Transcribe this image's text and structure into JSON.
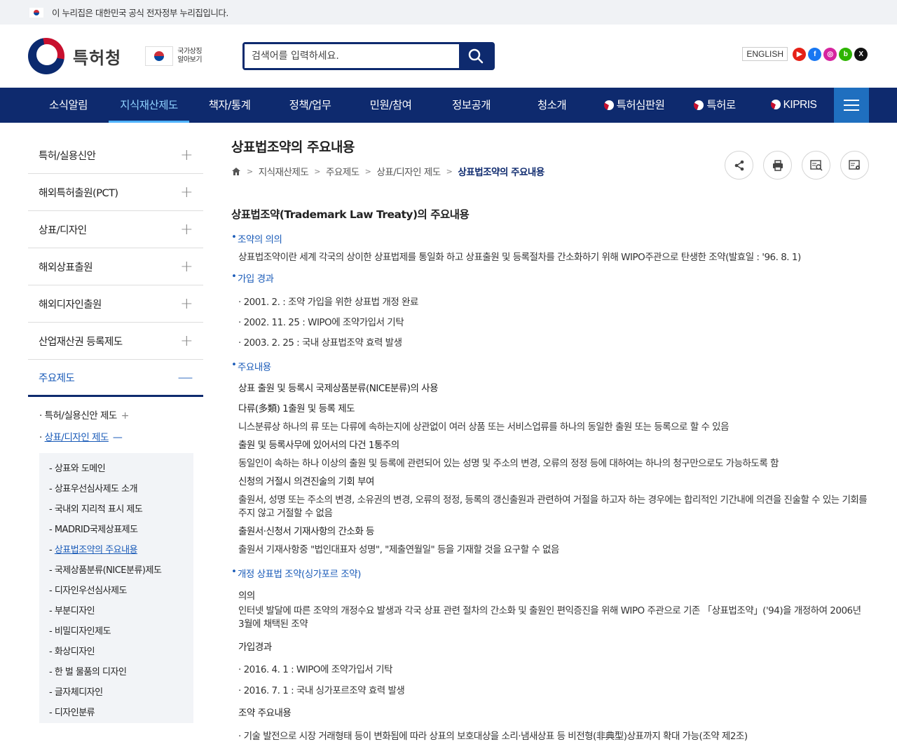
{
  "gov_banner": {
    "text": "이 누리집은 대한민국 공식 전자정부 누리집입니다."
  },
  "header": {
    "logo_text": "특허청",
    "symbol_line1": "국가상징",
    "symbol_line2": "알아보기",
    "search_placeholder": "검색어를 입력하세요.",
    "english": "ENGLISH",
    "sns": [
      {
        "name": "youtube",
        "glyph": "▶",
        "color": "#e62117"
      },
      {
        "name": "facebook",
        "glyph": "f",
        "color": "#1877f2"
      },
      {
        "name": "instagram",
        "glyph": "◎",
        "color": "#d6249f"
      },
      {
        "name": "blog",
        "glyph": "b",
        "color": "#2db400"
      },
      {
        "name": "x",
        "glyph": "X",
        "color": "#111111"
      }
    ]
  },
  "gnb": {
    "items": [
      "소식알림",
      "지식재산제도",
      "책자/통계",
      "정책/업무",
      "민원/참여",
      "정보공개",
      "청소개",
      "특허심판원",
      "특허로",
      "KIPRIS"
    ]
  },
  "lnb": {
    "items": [
      "특허/실용신안",
      "해외특허출원(PCT)",
      "상표/디자인",
      "해외상표출원",
      "해외디자인출원",
      "산업재산권 등록제도",
      "주요제도"
    ],
    "sub": [
      "특허/실용신안 제도",
      "상표/디자인 제도"
    ],
    "third": [
      "상표와 도메인",
      "상표우선심사제도 소개",
      "국내외 지리적 표시 제도",
      "MADRID국제상표제도",
      "상표법조약의 주요내용",
      "국제상품분류(NICE분류)제도",
      "디자인우선심사제도",
      "부분디자인",
      "비밀디자인제도",
      "화상디자인",
      "한 벌 물품의 디자인",
      "글자체디자인",
      "디자인분류"
    ]
  },
  "content": {
    "title": "상표법조약의 주요내용",
    "breadcrumb": [
      "지식재산제도",
      "주요제도",
      "상표/디자인 제도",
      "상표법조약의 주요내용"
    ],
    "h3": "상표법조약(Trademark Law Treaty)의 주요내용",
    "s1_title": "조약의 의의",
    "s1_text": "상표법조약이란 세계 각국의 상이한 상표법제를 통일화 하고 상표출원 및 등록절차를 간소화하기 위해 WIPO주관으로 탄생한 조약(발효일 : '96. 8. 1)",
    "s2_title": "가입 경과",
    "s2_list": [
      "· 2001. 2. : 조약 가입을 위한 상표법 개정 완료",
      "· 2002. 11. 25 : WIPO에 조약가입서 기탁",
      "· 2003. 2. 25 : 국내 상표법조약 효력 발생"
    ],
    "s3_title": "주요내용",
    "s3_a": "상표 출원 및 등록시 국제상품분류(NICE분류)의 사용",
    "s3_b": "다류(多類) 1출원 및 등록 제도",
    "s3_b_text": "니스분류상 하나의 류 또는 다류에 속하는지에 상관없이 여러 상품 또는 서비스업류를 하나의 동일한 출원 또는 등록으로 할 수 있음",
    "s3_c": "출원 및 등록사무에 있어서의 다건 1통주의",
    "s3_c_text": "동일인이 속하는 하나 이상의 출원 및 등록에 관련되어 있는 성명 및 주소의 변경, 오류의 정정 등에 대하여는 하나의 청구만으로도 가능하도록 함",
    "s3_d": "신청의 거절시 의견진술의 기회 부여",
    "s3_d_text": "출원서, 성명 또는 주소의 변경, 소유권의 변경, 오류의 정정, 등록의 갱신출원과 관련하여 거절을 하고자 하는 경우에는 합리적인 기간내에 의견을 진술할 수 있는 기회를 주지 않고 거절할 수 없음",
    "s3_e": "출원서·신청서 기재사항의 간소화 등",
    "s3_e_text": "출원서 기재사항중 \"법인대표자 성명\", \"제출연월일\" 등을 기재할 것을 요구할 수 없음",
    "s4_title": "개정 상표법 조약(싱가포르 조약)",
    "s4_a": "의의",
    "s4_a_text": "인터넷 발달에 따른 조약의 개정수요 발생과 각국 상표 관련 절차의 간소화 및 출원인 편익증진을 위해 WIPO 주관으로 기존 「상표법조약」('94)을 개정하여 2006년 3월에 채택된 조약",
    "s4_b": "가입경과",
    "s4_b_list": [
      "· 2016. 4. 1 : WIPO에 조약가입서 기탁",
      "· 2016. 7. 1 : 국내 싱가포르조약 효력 발생"
    ],
    "s4_c": "조약 주요내용",
    "s4_c_list": [
      "· 기술 발전으로 시장 거래형태 등이 변화됨에 따라 상표의 보호대상을 소리·냄새상표 등 비전형(非典型)상표까지 확대 가능(조약 제2조)"
    ]
  }
}
